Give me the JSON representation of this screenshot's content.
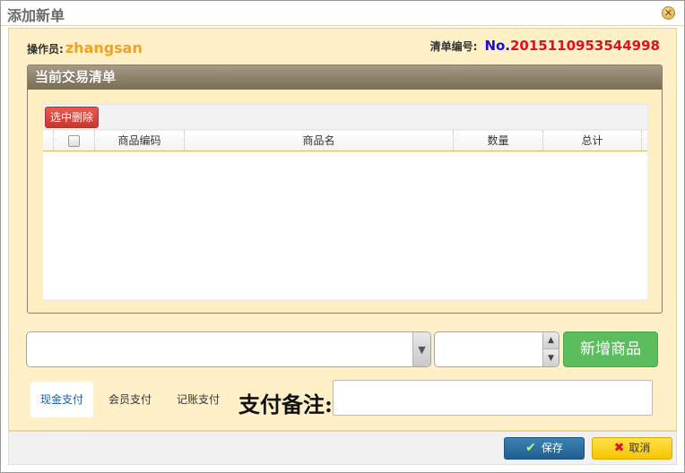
{
  "window": {
    "title": "添加新单",
    "close_icon": "close-icon"
  },
  "header": {
    "operator_label": "操作员:",
    "operator_name": "zhangsan",
    "order_label": "清单编号:",
    "order_prefix": "No.",
    "order_number": "2015110953544998"
  },
  "panel": {
    "title": "当前交易清单",
    "delete_button": "选中删除",
    "columns": [
      "商品编码",
      "商品名",
      "数量",
      "总计"
    ]
  },
  "controls": {
    "product_select_value": "",
    "quantity_value": "",
    "add_button": "新增商品"
  },
  "payment": {
    "tabs": [
      "现金支付",
      "会员支付",
      "记账支付"
    ],
    "selected": "现金支付",
    "note_label": "支付备注:",
    "note_value": ""
  },
  "footer": {
    "save_label": "保存",
    "cancel_label": "取消"
  },
  "colors": {
    "operator": "#f3a21f",
    "order_prefix": "#1410d6",
    "order_number": "#e3101e",
    "add_button": "#5bbd5e"
  }
}
